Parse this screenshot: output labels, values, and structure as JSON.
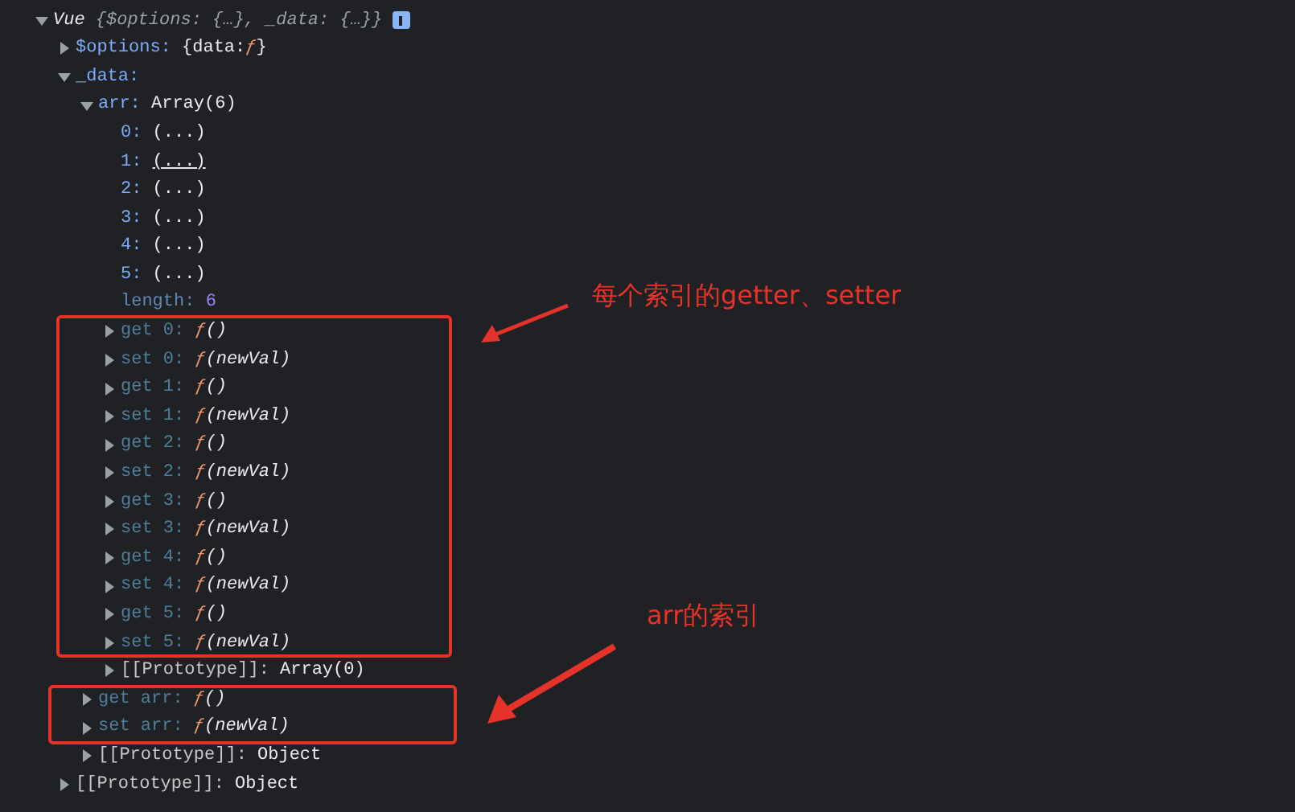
{
  "tree": [
    {
      "key": "Vue",
      "kind": "class",
      "expanded": true,
      "info": true,
      "value": [
        {
          "text": "{$options: {…}, _data: {…}}",
          "kind": "summary"
        }
      ],
      "children": [
        {
          "key": "$options:",
          "kind": "own",
          "expanded": false,
          "value": [
            {
              "text": "{data: ",
              "kind": "plain"
            },
            {
              "text": "ƒ",
              "kind": "func"
            },
            {
              "text": "}",
              "kind": "plain"
            }
          ]
        },
        {
          "key": "_data:",
          "kind": "own",
          "expanded": true,
          "children": [
            {
              "key": "arr:",
              "kind": "own",
              "expanded": true,
              "value": [
                {
                  "text": "Array(6)",
                  "kind": "plain"
                }
              ],
              "children": [
                {
                  "key": "0:",
                  "kind": "index",
                  "value": [
                    {
                      "text": "(...)",
                      "kind": "getter",
                      "hovered": false
                    }
                  ]
                },
                {
                  "key": "1:",
                  "kind": "index",
                  "value": [
                    {
                      "text": "(...)",
                      "kind": "getter",
                      "hovered": true
                    }
                  ]
                },
                {
                  "key": "2:",
                  "kind": "index",
                  "value": [
                    {
                      "text": "(...)",
                      "kind": "getter",
                      "hovered": false
                    }
                  ]
                },
                {
                  "key": "3:",
                  "kind": "index",
                  "value": [
                    {
                      "text": "(...)",
                      "kind": "getter",
                      "hovered": false
                    }
                  ]
                },
                {
                  "key": "4:",
                  "kind": "index",
                  "value": [
                    {
                      "text": "(...)",
                      "kind": "getter",
                      "hovered": false
                    }
                  ]
                },
                {
                  "key": "5:",
                  "kind": "index",
                  "value": [
                    {
                      "text": "(...)",
                      "kind": "getter",
                      "hovered": false
                    }
                  ]
                },
                {
                  "key": "length:",
                  "kind": "dim",
                  "value": [
                    {
                      "text": "6",
                      "kind": "number"
                    }
                  ]
                },
                {
                  "key": "get 0:",
                  "kind": "accessor",
                  "expanded": false,
                  "value": [
                    {
                      "text": "ƒ",
                      "kind": "func"
                    },
                    {
                      "text": " ()",
                      "kind": "params"
                    }
                  ]
                },
                {
                  "key": "set 0:",
                  "kind": "accessor",
                  "expanded": false,
                  "value": [
                    {
                      "text": "ƒ",
                      "kind": "func"
                    },
                    {
                      "text": " (newVal)",
                      "kind": "params"
                    }
                  ]
                },
                {
                  "key": "get 1:",
                  "kind": "accessor",
                  "expanded": false,
                  "value": [
                    {
                      "text": "ƒ",
                      "kind": "func"
                    },
                    {
                      "text": " ()",
                      "kind": "params"
                    }
                  ]
                },
                {
                  "key": "set 1:",
                  "kind": "accessor",
                  "expanded": false,
                  "value": [
                    {
                      "text": "ƒ",
                      "kind": "func"
                    },
                    {
                      "text": " (newVal)",
                      "kind": "params"
                    }
                  ]
                },
                {
                  "key": "get 2:",
                  "kind": "accessor",
                  "expanded": false,
                  "value": [
                    {
                      "text": "ƒ",
                      "kind": "func"
                    },
                    {
                      "text": " ()",
                      "kind": "params"
                    }
                  ]
                },
                {
                  "key": "set 2:",
                  "kind": "accessor",
                  "expanded": false,
                  "value": [
                    {
                      "text": "ƒ",
                      "kind": "func"
                    },
                    {
                      "text": " (newVal)",
                      "kind": "params"
                    }
                  ]
                },
                {
                  "key": "get 3:",
                  "kind": "accessor",
                  "expanded": false,
                  "value": [
                    {
                      "text": "ƒ",
                      "kind": "func"
                    },
                    {
                      "text": " ()",
                      "kind": "params"
                    }
                  ]
                },
                {
                  "key": "set 3:",
                  "kind": "accessor",
                  "expanded": false,
                  "value": [
                    {
                      "text": "ƒ",
                      "kind": "func"
                    },
                    {
                      "text": " (newVal)",
                      "kind": "params"
                    }
                  ]
                },
                {
                  "key": "get 4:",
                  "kind": "accessor",
                  "expanded": false,
                  "value": [
                    {
                      "text": "ƒ",
                      "kind": "func"
                    },
                    {
                      "text": " ()",
                      "kind": "params"
                    }
                  ]
                },
                {
                  "key": "set 4:",
                  "kind": "accessor",
                  "expanded": false,
                  "value": [
                    {
                      "text": "ƒ",
                      "kind": "func"
                    },
                    {
                      "text": " (newVal)",
                      "kind": "params"
                    }
                  ]
                },
                {
                  "key": "get 5:",
                  "kind": "accessor",
                  "expanded": false,
                  "value": [
                    {
                      "text": "ƒ",
                      "kind": "func"
                    },
                    {
                      "text": " ()",
                      "kind": "params"
                    }
                  ]
                },
                {
                  "key": "set 5:",
                  "kind": "accessor",
                  "expanded": false,
                  "value": [
                    {
                      "text": "ƒ",
                      "kind": "func"
                    },
                    {
                      "text": " (newVal)",
                      "kind": "params"
                    }
                  ]
                },
                {
                  "key": "[[Prototype]]:",
                  "kind": "internal",
                  "expanded": false,
                  "value": [
                    {
                      "text": "Array(0)",
                      "kind": "plain"
                    }
                  ]
                }
              ]
            },
            {
              "key": "get arr:",
              "kind": "accessor",
              "expanded": false,
              "value": [
                {
                  "text": "ƒ",
                  "kind": "func"
                },
                {
                  "text": " ()",
                  "kind": "params"
                }
              ]
            },
            {
              "key": "set arr:",
              "kind": "accessor",
              "expanded": false,
              "value": [
                {
                  "text": "ƒ",
                  "kind": "func"
                },
                {
                  "text": " (newVal)",
                  "kind": "params"
                }
              ]
            },
            {
              "key": "[[Prototype]]:",
              "kind": "internal",
              "expanded": false,
              "value": [
                {
                  "text": "Object",
                  "kind": "plain"
                }
              ]
            }
          ]
        },
        {
          "key": "[[Prototype]]:",
          "kind": "internal",
          "expanded": false,
          "value": [
            {
              "text": "Object",
              "kind": "plain"
            }
          ]
        }
      ]
    }
  ],
  "annotations": [
    {
      "text": "每个索引的getter、setter"
    },
    {
      "text": "arr的索引"
    }
  ]
}
